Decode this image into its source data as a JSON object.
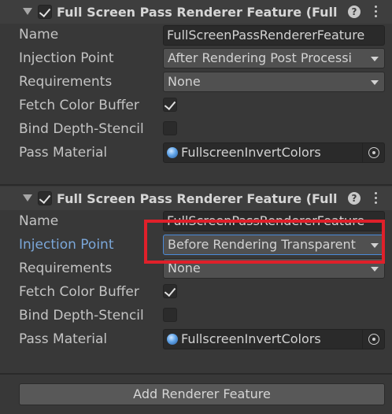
{
  "features": [
    {
      "header_title": "Full Screen Pass Renderer Feature (Full S",
      "enabled": true,
      "name_label": "Name",
      "name_value": "FullScreenPassRendererFeature",
      "injection_label": "Injection Point",
      "injection_value": "After Rendering Post Processi",
      "requirements_label": "Requirements",
      "requirements_value": "None",
      "fetch_label": "Fetch Color Buffer",
      "fetch_checked": true,
      "bind_label": "Bind Depth-Stencil",
      "bind_checked": false,
      "material_label": "Pass Material",
      "material_value": "FullscreenInvertColors"
    },
    {
      "header_title": "Full Screen Pass Renderer Feature (Full S",
      "enabled": true,
      "name_label": "Name",
      "name_value": "FullScreenPassRendererFeature",
      "injection_label": "Injection Point",
      "injection_value": "Before Rendering Transparent",
      "requirements_label": "Requirements",
      "requirements_value": "None",
      "fetch_label": "Fetch Color Buffer",
      "fetch_checked": true,
      "bind_label": "Bind Depth-Stencil",
      "bind_checked": false,
      "material_label": "Pass Material",
      "material_value": "FullscreenInvertColors"
    }
  ],
  "help_glyph": "?",
  "add_button_label": "Add Renderer Feature",
  "colors": {
    "background": "#383838",
    "active_label": "#7ba7d9",
    "focus_border": "#4a8ad8",
    "highlight_box": "#e0202a"
  },
  "icons": [
    "foldout-arrow-icon",
    "checkbox-icon",
    "help-icon",
    "kebab-menu-icon",
    "dropdown-arrow-icon",
    "material-icon",
    "object-picker-icon"
  ]
}
